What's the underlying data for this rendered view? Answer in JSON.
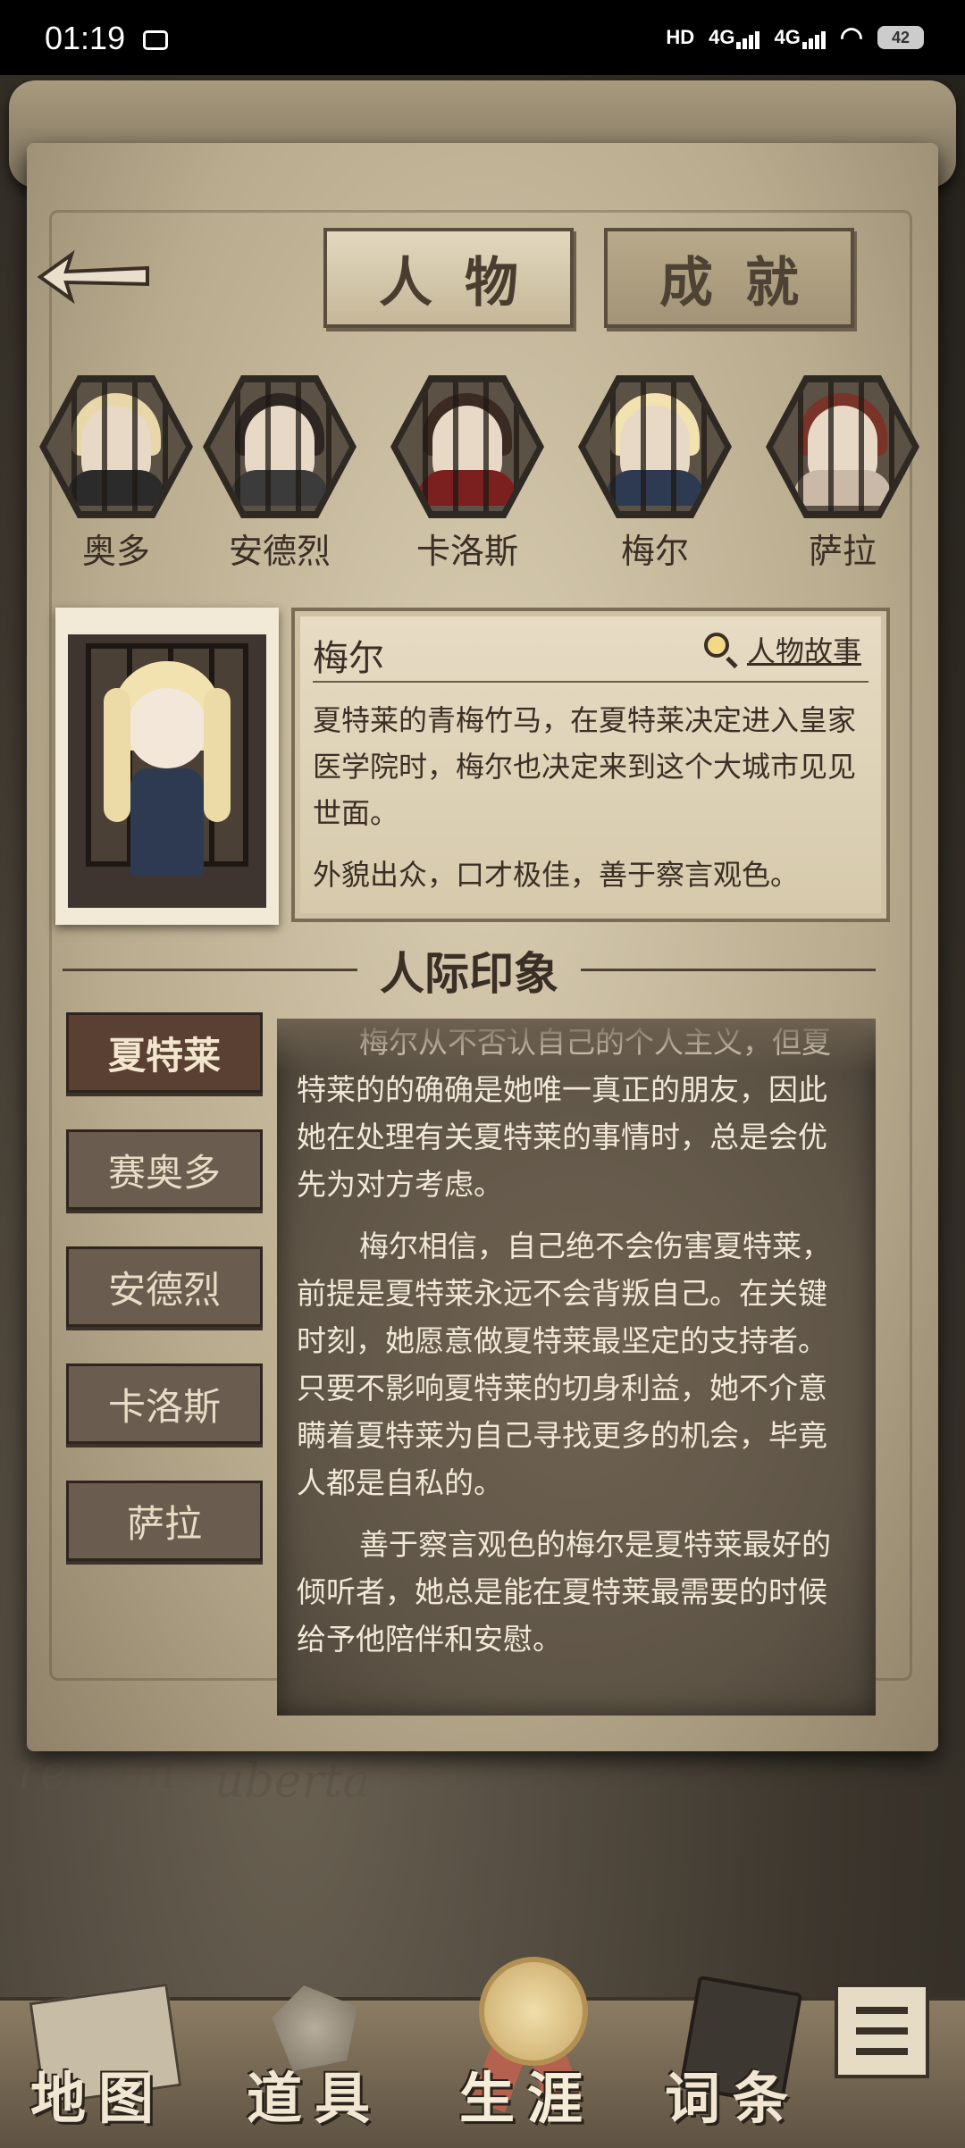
{
  "status_bar": {
    "time": "01:19",
    "network_label": "HD",
    "signal1": "4G",
    "signal2": "4G",
    "battery": "42"
  },
  "tabs": [
    {
      "label": "人物",
      "active": true
    },
    {
      "label": "成就",
      "active": false
    }
  ],
  "characters": [
    {
      "name": "奥多",
      "hair": "#e8d7a8",
      "outfit": "#2b2b2b"
    },
    {
      "name": "安德烈",
      "hair": "#2d2622",
      "outfit": "#3b3b3b"
    },
    {
      "name": "卡洛斯",
      "hair": "#3a2a22",
      "outfit": "#7c1f1f"
    },
    {
      "name": "梅尔",
      "hair": "#f1e2b0",
      "outfit": "#2e3a52"
    },
    {
      "name": "萨拉",
      "hair": "#7a3328",
      "outfit": "#c9b9a6"
    }
  ],
  "selected_character": {
    "name": "梅尔",
    "story_button": "人物故事",
    "description": "夏特莱的青梅竹马，在夏特莱决定进入皇家医学院时，梅尔也决定来到这个大城市见见世面。",
    "traits": "外貌出众，口才极佳，善于察言观色。"
  },
  "impressions": {
    "title": "人际印象",
    "tabs": [
      "夏特莱",
      "赛奥多",
      "安德烈",
      "卡洛斯",
      "萨拉"
    ],
    "active_tab": 0,
    "paragraphs": [
      "梅尔从不否认自己的个人主义，但夏特莱的的确确是她唯一真正的朋友，因此她在处理有关夏特莱的事情时，总是会优先为对方考虑。",
      "梅尔相信，自己绝不会伤害夏特莱，前提是夏特莱永远不会背叛自己。在关键时刻，她愿意做夏特莱最坚定的支持者。只要不影响夏特莱的切身利益，她不介意瞒着夏特莱为自己寻找更多的机会，毕竟人都是自私的。",
      "善于察言观色的梅尔是夏特莱最好的倾听者，她总是能在夏特莱最需要的时候给予他陪伴和安慰。"
    ]
  },
  "bottom_nav": [
    {
      "label": "地图"
    },
    {
      "label": "道具"
    },
    {
      "label": "生涯"
    },
    {
      "label": "词条"
    }
  ],
  "background_text": [
    "retium",
    "uberta"
  ],
  "colors": {
    "parchment": "#d9cdb2",
    "ink": "#3a2f25",
    "active_tab": "#5a3f33"
  }
}
